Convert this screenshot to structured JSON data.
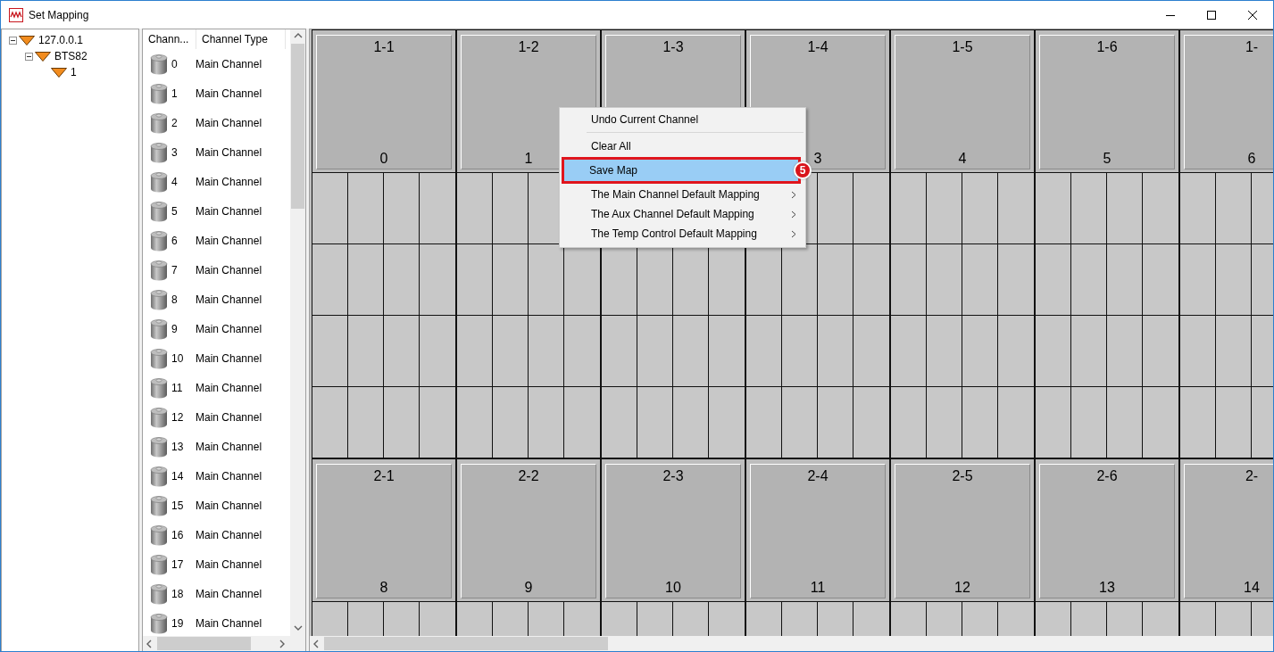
{
  "window": {
    "title": "Set Mapping"
  },
  "tree": [
    {
      "label": "127.0.0.1",
      "expanded": true,
      "children": [
        {
          "label": "BTS82",
          "expanded": true,
          "children": [
            {
              "label": "1"
            }
          ]
        }
      ]
    }
  ],
  "channel_list": {
    "columns": [
      "Chann...",
      "Channel Type"
    ],
    "rows": [
      {
        "number": "0",
        "type": "Main Channel"
      },
      {
        "number": "1",
        "type": "Main Channel"
      },
      {
        "number": "2",
        "type": "Main Channel"
      },
      {
        "number": "3",
        "type": "Main Channel"
      },
      {
        "number": "4",
        "type": "Main Channel"
      },
      {
        "number": "5",
        "type": "Main Channel"
      },
      {
        "number": "6",
        "type": "Main Channel"
      },
      {
        "number": "7",
        "type": "Main Channel"
      },
      {
        "number": "8",
        "type": "Main Channel"
      },
      {
        "number": "9",
        "type": "Main Channel"
      },
      {
        "number": "10",
        "type": "Main Channel"
      },
      {
        "number": "11",
        "type": "Main Channel"
      },
      {
        "number": "12",
        "type": "Main Channel"
      },
      {
        "number": "13",
        "type": "Main Channel"
      },
      {
        "number": "14",
        "type": "Main Channel"
      },
      {
        "number": "15",
        "type": "Main Channel"
      },
      {
        "number": "16",
        "type": "Main Channel"
      },
      {
        "number": "17",
        "type": "Main Channel"
      },
      {
        "number": "18",
        "type": "Main Channel"
      },
      {
        "number": "19",
        "type": "Main Channel"
      }
    ]
  },
  "mapping_grid": {
    "blocks": [
      {
        "cards": [
          {
            "title": "1-1",
            "channel": "0"
          },
          {
            "title": "1-2",
            "channel": "1"
          },
          {
            "title": "1-3"
          },
          {
            "title": "1-4",
            "channel": "3"
          },
          {
            "title": "1-5",
            "channel": "4"
          },
          {
            "title": "1-6",
            "channel": "5"
          },
          {
            "title": "1-",
            "channel": "6"
          }
        ]
      },
      {
        "cards": [
          {
            "title": "2-1",
            "channel": "8"
          },
          {
            "title": "2-2",
            "channel": "9"
          },
          {
            "title": "2-3",
            "channel": "10"
          },
          {
            "title": "2-4",
            "channel": "11"
          },
          {
            "title": "2-5",
            "channel": "12"
          },
          {
            "title": "2-6",
            "channel": "13"
          },
          {
            "title": "2-",
            "channel": "14"
          }
        ]
      }
    ]
  },
  "context_menu": {
    "items": [
      {
        "kind": "item",
        "label": "Undo Current Channel",
        "selected": false,
        "submenu": false
      },
      {
        "kind": "separator"
      },
      {
        "kind": "item",
        "label": "Clear All",
        "selected": false,
        "submenu": false
      },
      {
        "kind": "item",
        "label": "Save Map",
        "selected": true,
        "submenu": false,
        "highlighted": true,
        "callout": "5"
      },
      {
        "kind": "item",
        "label": "The Main Channel Default Mapping",
        "selected": false,
        "submenu": true
      },
      {
        "kind": "item",
        "label": "The Aux Channel Default Mapping",
        "selected": false,
        "submenu": true
      },
      {
        "kind": "item",
        "label": "The Temp Control Default Mapping",
        "selected": false,
        "submenu": true
      }
    ]
  }
}
